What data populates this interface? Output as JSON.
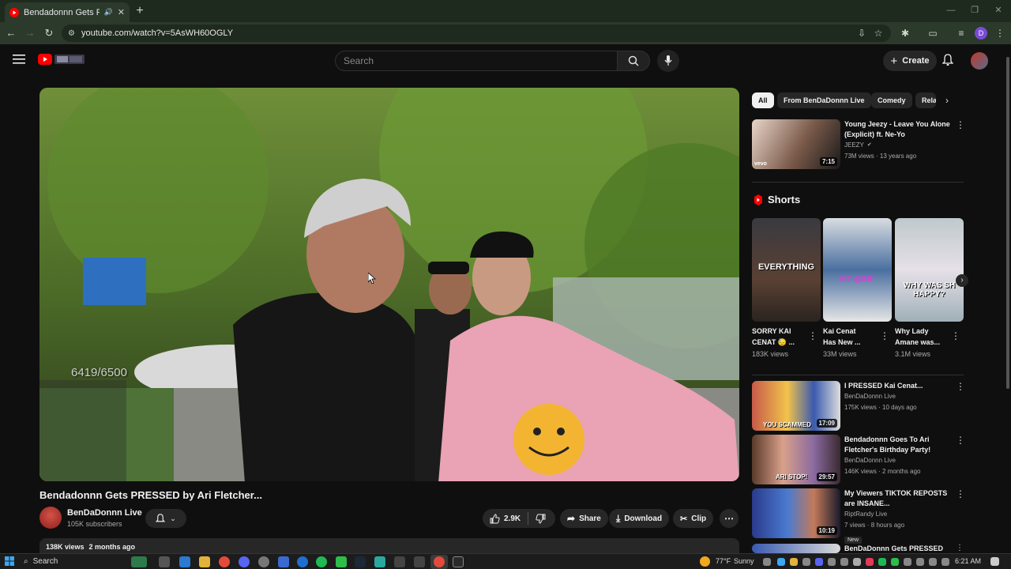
{
  "browser": {
    "tab_title": "Bendadonnn Gets PRESSED",
    "new_tab": "+",
    "url": "youtube.com/watch?v=5AsWH60OGLY",
    "profile_initial": "D"
  },
  "youtube": {
    "search_placeholder": "Search",
    "create_label": "Create"
  },
  "video": {
    "overlay_count": "6419/6500",
    "title": "Bendadonnn Gets PRESSED by Ari Fletcher...",
    "channel": "BenDaDonnn Live",
    "subscribers": "105K subscribers",
    "likes": "2.9K",
    "share_label": "Share",
    "download_label": "Download",
    "clip_label": "Clip",
    "views": "138K views",
    "age": "2 months ago"
  },
  "chips": [
    "All",
    "From BenDaDonnn Live",
    "Comedy",
    "Rela"
  ],
  "recommended_top": {
    "title_line1": "Young Jeezy - Leave You Alone",
    "title_line2": "(Explicit) ft. Ne-Yo",
    "channel": "JEEZY",
    "meta": "73M views · 13 years ago",
    "duration": "7:15",
    "badge": "vevo"
  },
  "shorts": {
    "heading": "Shorts",
    "items": [
      {
        "overlay": "EVERYTHING",
        "line1": "SORRY KAI",
        "line2": "CENAT 😓 ...",
        "views": "183K views"
      },
      {
        "overlay": "MY @SS!",
        "line1": "Kai Cenat",
        "line2": "Has New ...",
        "views": "33M views"
      },
      {
        "overlay": "WHY WAS SH HAPPY?",
        "line1": "Why Lady",
        "line2": "Amane was...",
        "views": "3.1M views"
      }
    ]
  },
  "recommended": [
    {
      "line1": "I PRESSED Kai Cenat...",
      "line2": "",
      "channel": "BenDaDonnn Live",
      "meta": "175K views · 10 days ago",
      "duration": "17:09",
      "overlay": "YOU SCAMMED",
      "badge": ""
    },
    {
      "line1": "Bendadonnn Goes To Ari",
      "line2": "Fletcher's Birthday Party!",
      "channel": "BenDaDonnn Live",
      "meta": "146K views · 2 months ago",
      "duration": "29:57",
      "overlay": "ARI STOP!",
      "badge": ""
    },
    {
      "line1": "My Viewers TIKTOK REPOSTS",
      "line2": "are INSANE...",
      "channel": "RiptRandy Live",
      "meta": "7 views · 8 hours ago",
      "duration": "10:19",
      "overlay": "",
      "badge": "New"
    },
    {
      "line1": "BenDaDonnn Gets PRESSED For",
      "line2": "",
      "channel": "",
      "meta": "",
      "duration": "",
      "overlay": "",
      "badge": ""
    }
  ],
  "taskbar": {
    "search": "Search",
    "weather": "77°F",
    "weather_desc": "Sunny",
    "time": "6:21 AM"
  }
}
